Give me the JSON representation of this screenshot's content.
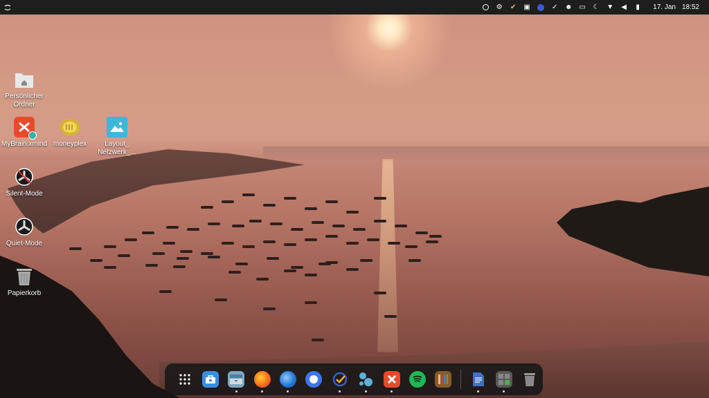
{
  "topbar": {
    "menu_icon": "activities-icon",
    "tray_icons": [
      "1password-icon",
      "network-share-icon",
      "todo-check-icon",
      "image-viewer-icon",
      "compass-icon",
      "check-circle-icon",
      "face-icon",
      "screen-cast-icon",
      "night-light-icon",
      "wifi-icon",
      "volume-icon",
      "battery-icon"
    ],
    "date": "17. Jan",
    "time": "18:52"
  },
  "desktop": {
    "icons": [
      {
        "label": "Persönlicher Ordner",
        "icon": "home-folder-icon"
      },
      {
        "label": "MyBrain.xmind",
        "icon": "xmind-file-icon"
      },
      {
        "label": "moneyplex",
        "icon": "moneyplex-icon"
      },
      {
        "label": "Layout_ Netzwerk_...",
        "icon": "image-file-icon"
      },
      {
        "label": "Silent-Mode",
        "icon": "fan-silent-icon"
      },
      {
        "label": "Quiet-Mode",
        "icon": "fan-quiet-icon"
      },
      {
        "label": "Papierkorb",
        "icon": "trash-icon"
      }
    ]
  },
  "dock": {
    "items": [
      {
        "name": "app-grid",
        "color": "#2b2b2b",
        "running": false
      },
      {
        "name": "software-store",
        "color": "#3a8ee0",
        "running": false
      },
      {
        "name": "files",
        "color": "#7fa7c4",
        "running": true
      },
      {
        "name": "firefox",
        "color": "#ff6a1a",
        "running": true
      },
      {
        "name": "thunderbird",
        "color": "#1f6fd1",
        "running": true
      },
      {
        "name": "signal",
        "color": "#3a76f0",
        "running": false
      },
      {
        "name": "ticktick",
        "color": "#2f4eb8",
        "running": true
      },
      {
        "name": "nextcloud-talk",
        "color": "#5fb1d8",
        "running": true
      },
      {
        "name": "xmind",
        "color": "#e94a2c",
        "running": true
      },
      {
        "name": "spotify",
        "color": "#1db954",
        "running": false
      },
      {
        "name": "bookshelf",
        "color": "#8b5a2b",
        "running": false
      },
      {
        "name": "document-viewer",
        "color": "#3f6fc9",
        "running": true
      },
      {
        "name": "calculator",
        "color": "#5a5a5a",
        "running": true
      },
      {
        "name": "trash",
        "color": "#777777",
        "running": false
      }
    ]
  }
}
